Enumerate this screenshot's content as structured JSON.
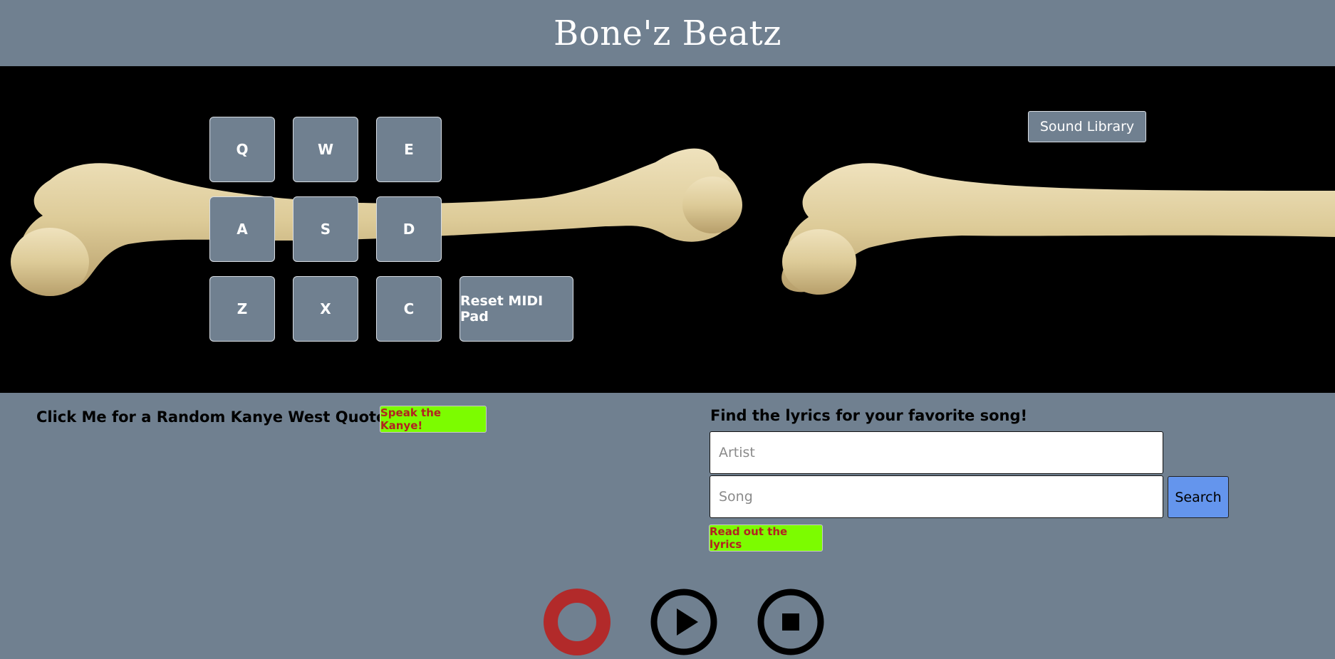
{
  "header": {
    "title": "Bone'z Beatz"
  },
  "midi_pad": {
    "keys": [
      "Q",
      "W",
      "E",
      "A",
      "S",
      "D",
      "Z",
      "X",
      "C"
    ],
    "reset_label": "Reset MIDI Pad"
  },
  "sound_library": {
    "label": "Sound Library"
  },
  "kanye": {
    "label": "Click Me for a Random Kanye West Quote!",
    "button_label": "Speak the Kanye!"
  },
  "lyrics": {
    "label": "Find the lyrics for your favorite song!",
    "artist_placeholder": "Artist",
    "artist_value": "",
    "song_placeholder": "Song",
    "song_value": "",
    "search_label": "Search",
    "read_label": "Read out the lyrics"
  },
  "controls": {
    "record_icon": "record-icon",
    "play_icon": "play-icon",
    "stop_icon": "stop-icon",
    "record_color": "#b22a2a",
    "play_stop_color": "#000000"
  },
  "colors": {
    "background": "#708090",
    "stage": "#000000",
    "accent_green": "#7cfc00",
    "accent_red_text": "#b22222",
    "search_blue": "#6495ed"
  }
}
